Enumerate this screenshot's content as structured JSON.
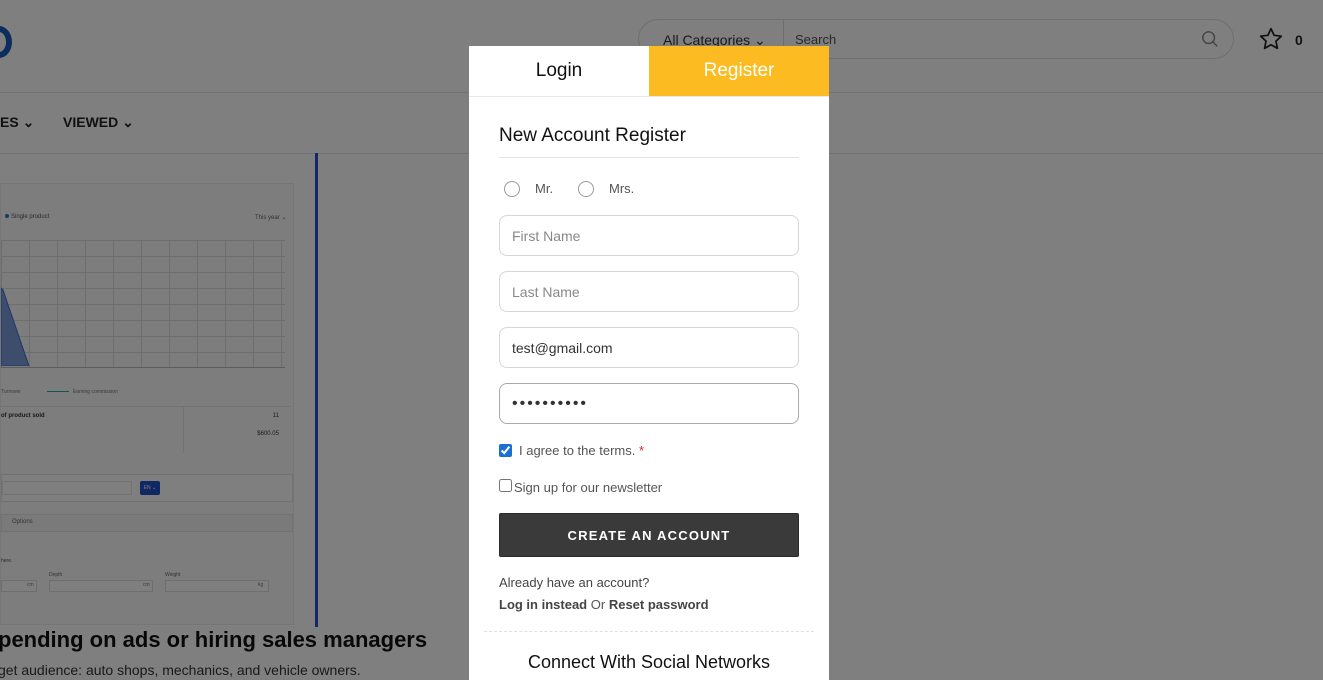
{
  "header": {
    "category_select": "All Categories",
    "search_placeholder": "Search",
    "wishlist_count": "0"
  },
  "nav": {
    "items_fragment": "ES",
    "viewed_label": "VIEWED"
  },
  "preview": {
    "legend_label": "Single product",
    "period_label": "This year",
    "legend_turnover": "Turnover",
    "legend_commission": "Earning commission",
    "stat_label": "of product sold",
    "stat_value_1": "11",
    "stat_value_2": "$600.05",
    "lang_button": "EN",
    "options_label": "Options",
    "note_fragment": "here.",
    "unit_cm_1": "cm",
    "unit_cm_2": "cm",
    "unit_kg": "kg",
    "depth_label": "Depth",
    "weight_label": "Weight"
  },
  "background": {
    "heading": "pending on ads or hiring sales managers",
    "subtext": "get audience: auto shops, mechanics, and vehicle owners."
  },
  "modal": {
    "tabs": {
      "login": "Login",
      "register": "Register"
    },
    "title": "New Account Register",
    "titles": {
      "mr": "Mr.",
      "mrs": "Mrs."
    },
    "fields": {
      "first_name_placeholder": "First Name",
      "last_name_placeholder": "Last Name",
      "email_value": "test@gmail.com",
      "password_value": "••••••••••"
    },
    "terms_label": "I agree to the terms.",
    "terms_required": "*",
    "terms_checked": true,
    "newsletter_label": "Sign up for our newsletter",
    "newsletter_checked": false,
    "create_button": "CREATE AN ACCOUNT",
    "already_text": "Already have an account?",
    "login_link": "Log in instead",
    "or_text": "Or",
    "reset_link": "Reset password",
    "social_title": "Connect With Social Networks"
  },
  "colors": {
    "accent": "#fbbb21",
    "button_dark": "#3a3a3a",
    "brand_blue": "#1a5ab8"
  }
}
